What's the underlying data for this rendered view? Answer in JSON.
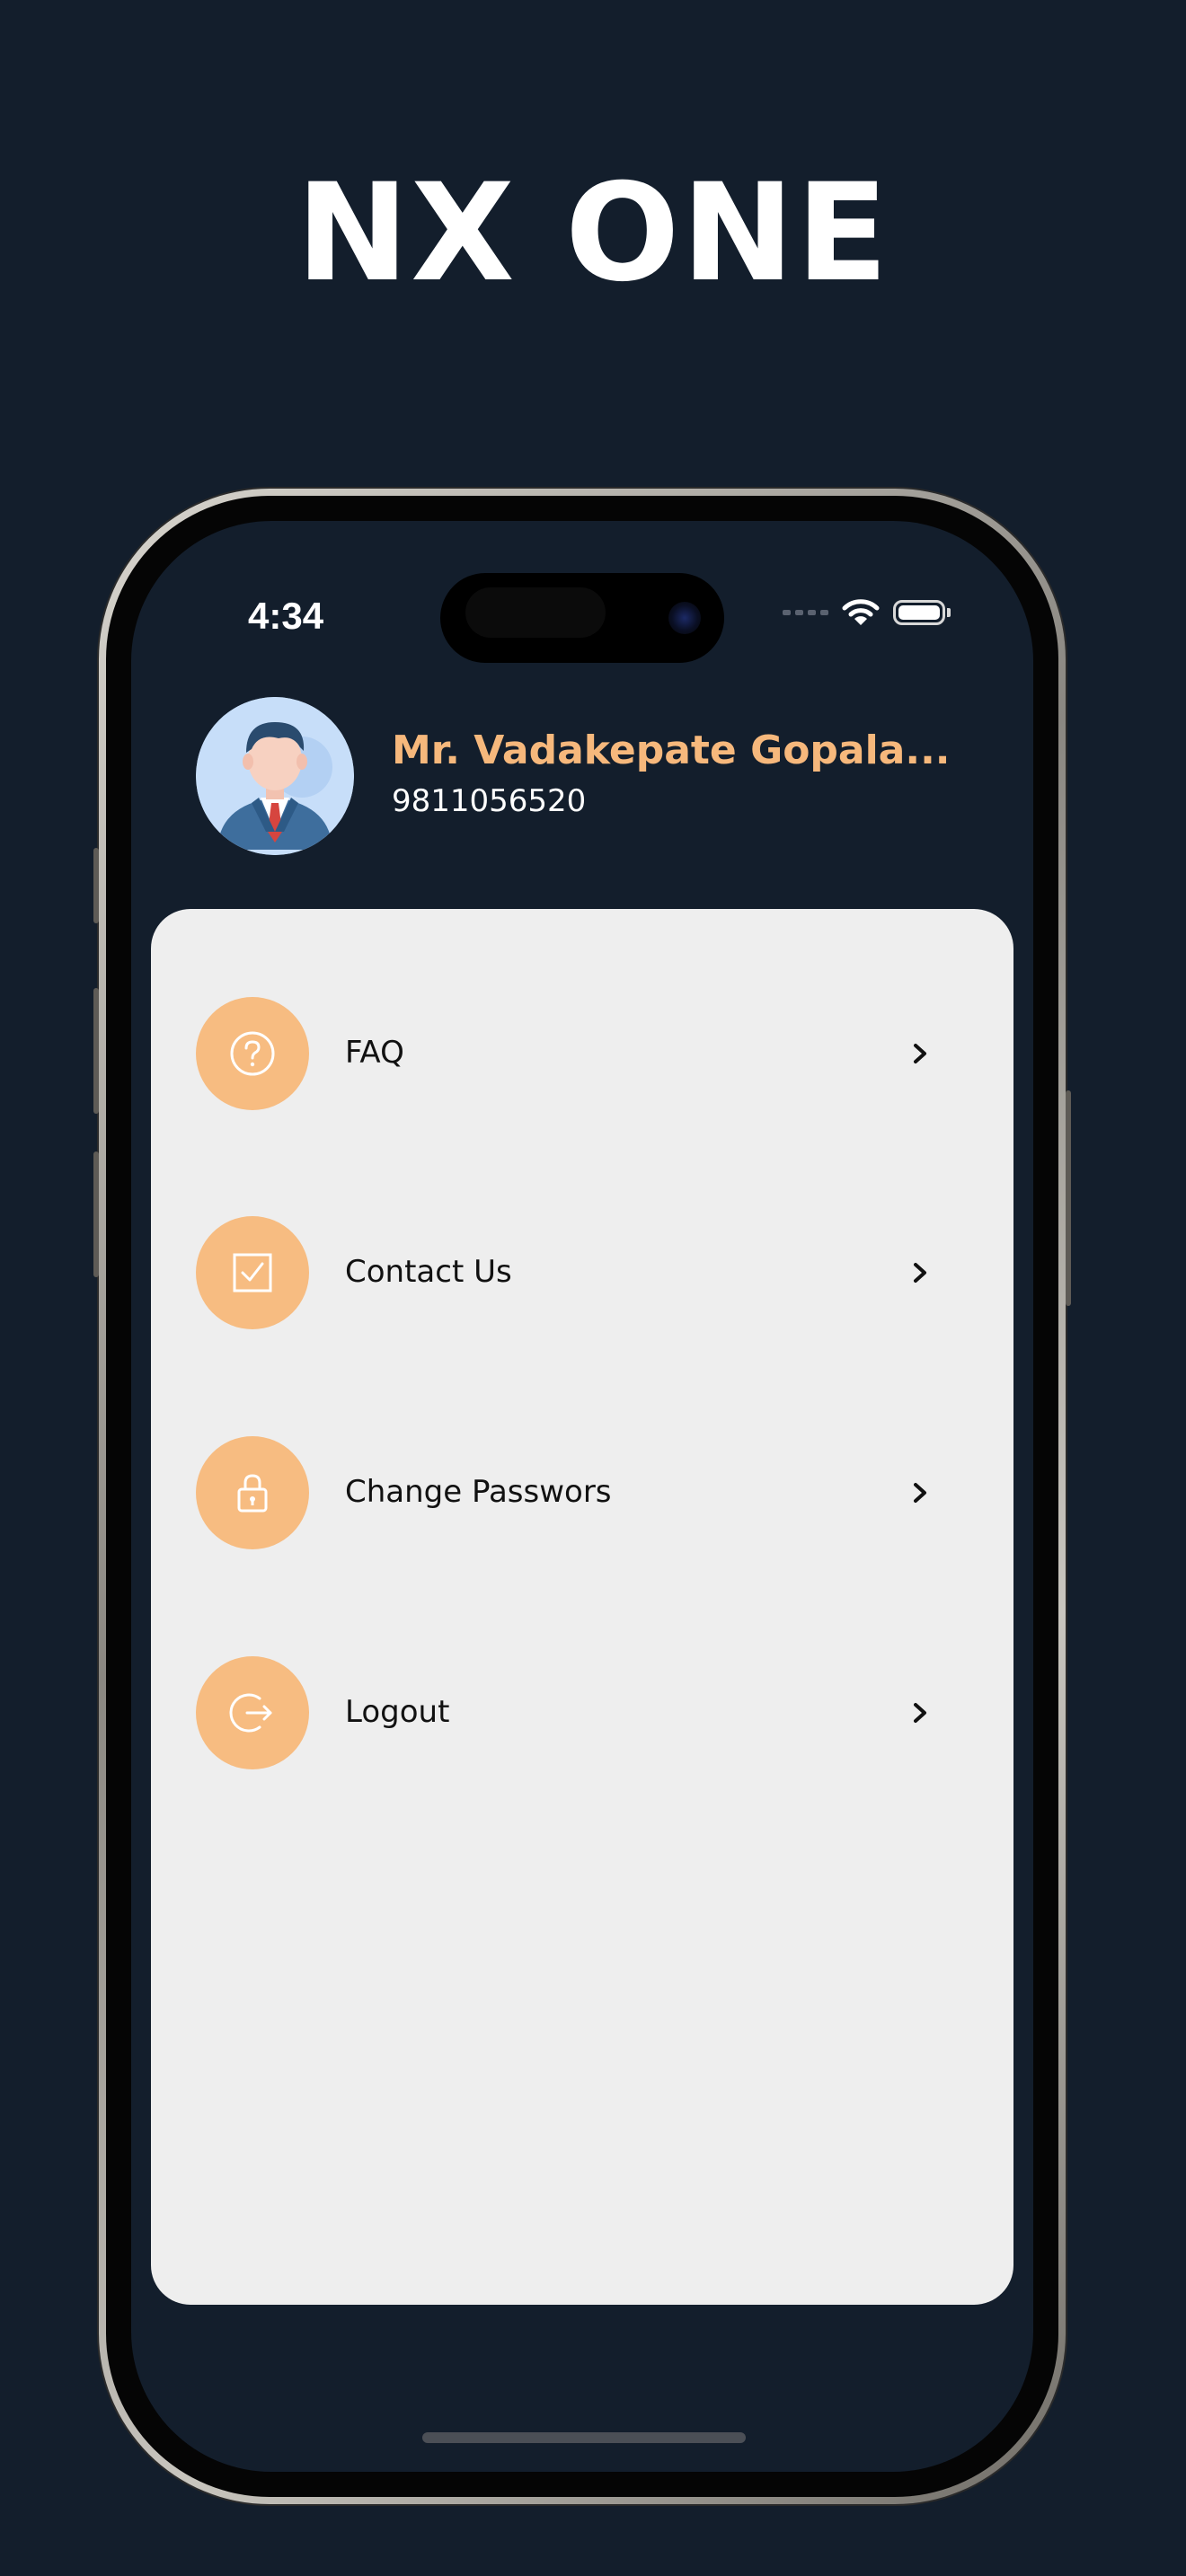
{
  "header": {
    "brand_title": "NX ONE"
  },
  "status_bar": {
    "time": "4:34"
  },
  "profile": {
    "name": "Mr. Vadakepate Gopala...",
    "phone": "9811056520"
  },
  "menu": {
    "items": [
      {
        "label": "FAQ",
        "icon": "question-circle-icon"
      },
      {
        "label": "Contact Us",
        "icon": "checkbox-icon"
      },
      {
        "label": "Change Passwors",
        "icon": "lock-icon"
      },
      {
        "label": "Logout",
        "icon": "logout-icon"
      }
    ]
  },
  "colors": {
    "background": "#131e2c",
    "accent": "#f7bc81",
    "name_text": "#f6b87c",
    "card": "#eeeeee"
  }
}
